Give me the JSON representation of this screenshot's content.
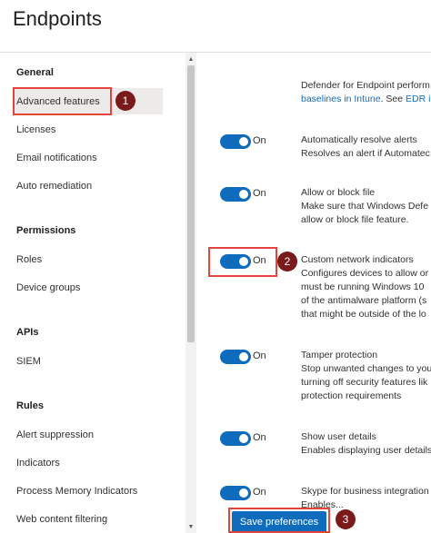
{
  "page": {
    "title": "Endpoints"
  },
  "sidebar": {
    "sections": [
      {
        "heading": "General",
        "items": [
          "Advanced features",
          "Licenses",
          "Email notifications",
          "Auto remediation"
        ]
      },
      {
        "heading": "Permissions",
        "items": [
          "Roles",
          "Device groups"
        ]
      },
      {
        "heading": "APIs",
        "items": [
          "SIEM"
        ]
      },
      {
        "heading": "Rules",
        "items": [
          "Alert suppression",
          "Indicators",
          "Process Memory Indicators",
          "Web content filtering"
        ]
      }
    ],
    "selected": "Advanced features"
  },
  "content": {
    "top_fragment": {
      "line1": "Defender for Endpoint perform",
      "link": "baselines in Intune",
      "line2_rest": ". See ",
      "link2": "EDR in"
    },
    "features": [
      {
        "toggle": "On",
        "title": "Automatically resolve alerts",
        "desc": [
          "Resolves an alert if Automatec"
        ]
      },
      {
        "toggle": "On",
        "title": "Allow or block file",
        "desc": [
          "Make sure that Windows Defe",
          "allow or block file feature."
        ]
      },
      {
        "toggle": "On",
        "title": "Custom network indicators",
        "desc": [
          "Configures devices to allow or",
          "must be running Windows 10",
          "of the antimalware platform (s",
          "that might be outside of the lo"
        ]
      },
      {
        "toggle": "On",
        "title": "Tamper protection",
        "desc": [
          "Stop unwanted changes to you",
          "turning off security features lik"
        ],
        "link": "protection requirements"
      },
      {
        "toggle": "On",
        "title": "Show user details",
        "desc": [
          "Enables displaying user details"
        ]
      },
      {
        "toggle": "On",
        "title": "Skype for business integration",
        "desc": [
          "Enables..."
        ]
      }
    ]
  },
  "actions": {
    "save_label": "Save preferences"
  },
  "annotations": [
    "1",
    "2",
    "3"
  ],
  "colors": {
    "accent": "#0f6cbd",
    "annotation_box": "#e4443a",
    "annotation_badge": "#7a1a1a"
  }
}
